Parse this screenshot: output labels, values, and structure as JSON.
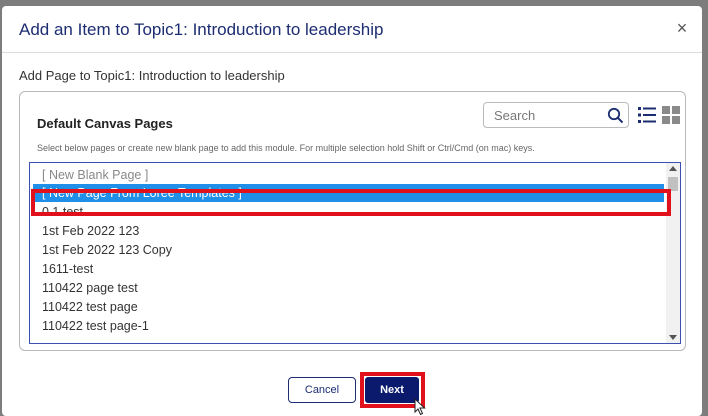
{
  "modal": {
    "title": "Add an Item to Topic1: Introduction to leadership",
    "close_label": "×",
    "subtitle": "Add Page to Topic1: Introduction to leadership"
  },
  "panel": {
    "heading": "Default Canvas Pages",
    "search_placeholder": "Search",
    "search_value": "",
    "helper_text": "Select below pages or create new blank page to add this module. For multiple selection hold Shift or Ctrl/Cmd (on mac) keys.",
    "icons": [
      "search-icon",
      "list-view-icon",
      "grid-view-icon"
    ],
    "items": [
      {
        "label": "[ New Blank Page ]",
        "state": "disabled"
      },
      {
        "label": "[ New Page From Loree Templates ]",
        "state": "selected"
      },
      {
        "label": "0.1 test",
        "state": "normal"
      },
      {
        "label": "1st Feb 2022 123",
        "state": "normal"
      },
      {
        "label": "1st Feb 2022 123 Copy",
        "state": "normal"
      },
      {
        "label": "1611-test",
        "state": "normal"
      },
      {
        "label": "110422 page test",
        "state": "normal"
      },
      {
        "label": "110422 test page",
        "state": "normal"
      },
      {
        "label": "110422 test page-1",
        "state": "normal"
      }
    ]
  },
  "footer": {
    "cancel_label": "Cancel",
    "next_label": "Next"
  },
  "colors": {
    "accent": "#1d2d72",
    "primary_button": "#0c1a6e",
    "selection": "#1f8fe8",
    "highlight_annotation": "#e0101c",
    "overlay": "#7d7d7d"
  }
}
